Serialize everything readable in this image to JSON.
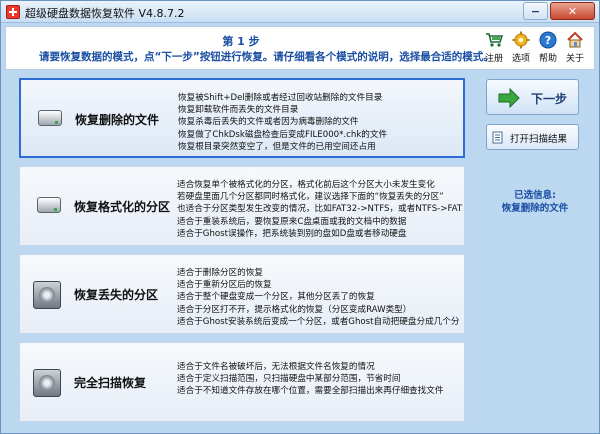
{
  "window": {
    "title": "超级硬盘数据恢复软件 V4.8.7.2",
    "min_label": "−",
    "close_label": "✕"
  },
  "header": {
    "step": "第 1 步",
    "instruction": "请要恢复数据的模式，点“下一步”按钮进行恢复。请仔细看各个模式的说明，选择最合适的模式。"
  },
  "toolbar": [
    {
      "label": "注册",
      "icon": "cart-icon"
    },
    {
      "label": "选项",
      "icon": "gear-icon"
    },
    {
      "label": "帮助",
      "icon": "help-icon"
    },
    {
      "label": "关于",
      "icon": "home-icon"
    }
  ],
  "modes": [
    {
      "name": "恢复删除的文件",
      "icon": "disk-icon",
      "selected": true,
      "lines": [
        "恢复被Shift+Del删除或者经过回收站删除的文件目录",
        "恢复卸载软件而丢失的文件目录",
        "恢复杀毒后丢失的文件或者因为病毒删除的文件",
        "恢复做了ChkDsk磁盘检查后变成FILE000*.chk的文件",
        "恢复根目录突然变空了，但是文件的已用空间还占用"
      ]
    },
    {
      "name": "恢复格式化的分区",
      "icon": "disk-icon",
      "selected": false,
      "lines": [
        "适合恢复单个被格式化的分区，格式化前后这个分区大小未发生变化",
        "若硬盘里面几个分区都同时格式化，建议选择下面的“恢复丢失的分区”",
        "也适合于分区类型发生改变的情况，比如FAT32->NTFS，或者NTFS->FAT3",
        "适合于重装系统后，要恢复原来C盘桌面或我的文档中的数据",
        "适合于Ghost误操作，把系统装到别的盘如D盘或者移动硬盘"
      ]
    },
    {
      "name": "恢复丢失的分区",
      "icon": "hdd-icon",
      "selected": false,
      "lines": [
        "适合于删除分区的恢复",
        "适合于重新分区后的恢复",
        "适合于整个硬盘变成一个分区，其他分区丢了的恢复",
        "适合于分区打不开，提示格式化的恢复（分区变成RAW类型）",
        "适合于Ghost安装系统后变成一个分区，或者Ghost自动把硬盘分成几个分"
      ]
    },
    {
      "name": "完全扫描恢复",
      "icon": "hdd-icon",
      "selected": false,
      "lines": [
        "适合于文件名被破坏后，无法根据文件名恢复的情况",
        "适合于定义扫描范围，只扫描硬盘中某部分范围，节省时间",
        "适合于不知道文件存放在哪个位置，需要全部扫描出来再仔细查找文件"
      ]
    }
  ],
  "actions": {
    "next_label": "下一步",
    "open_label": "打开扫描结果"
  },
  "selected_info": {
    "title": "已选信息:",
    "value": "恢复删除的文件"
  }
}
